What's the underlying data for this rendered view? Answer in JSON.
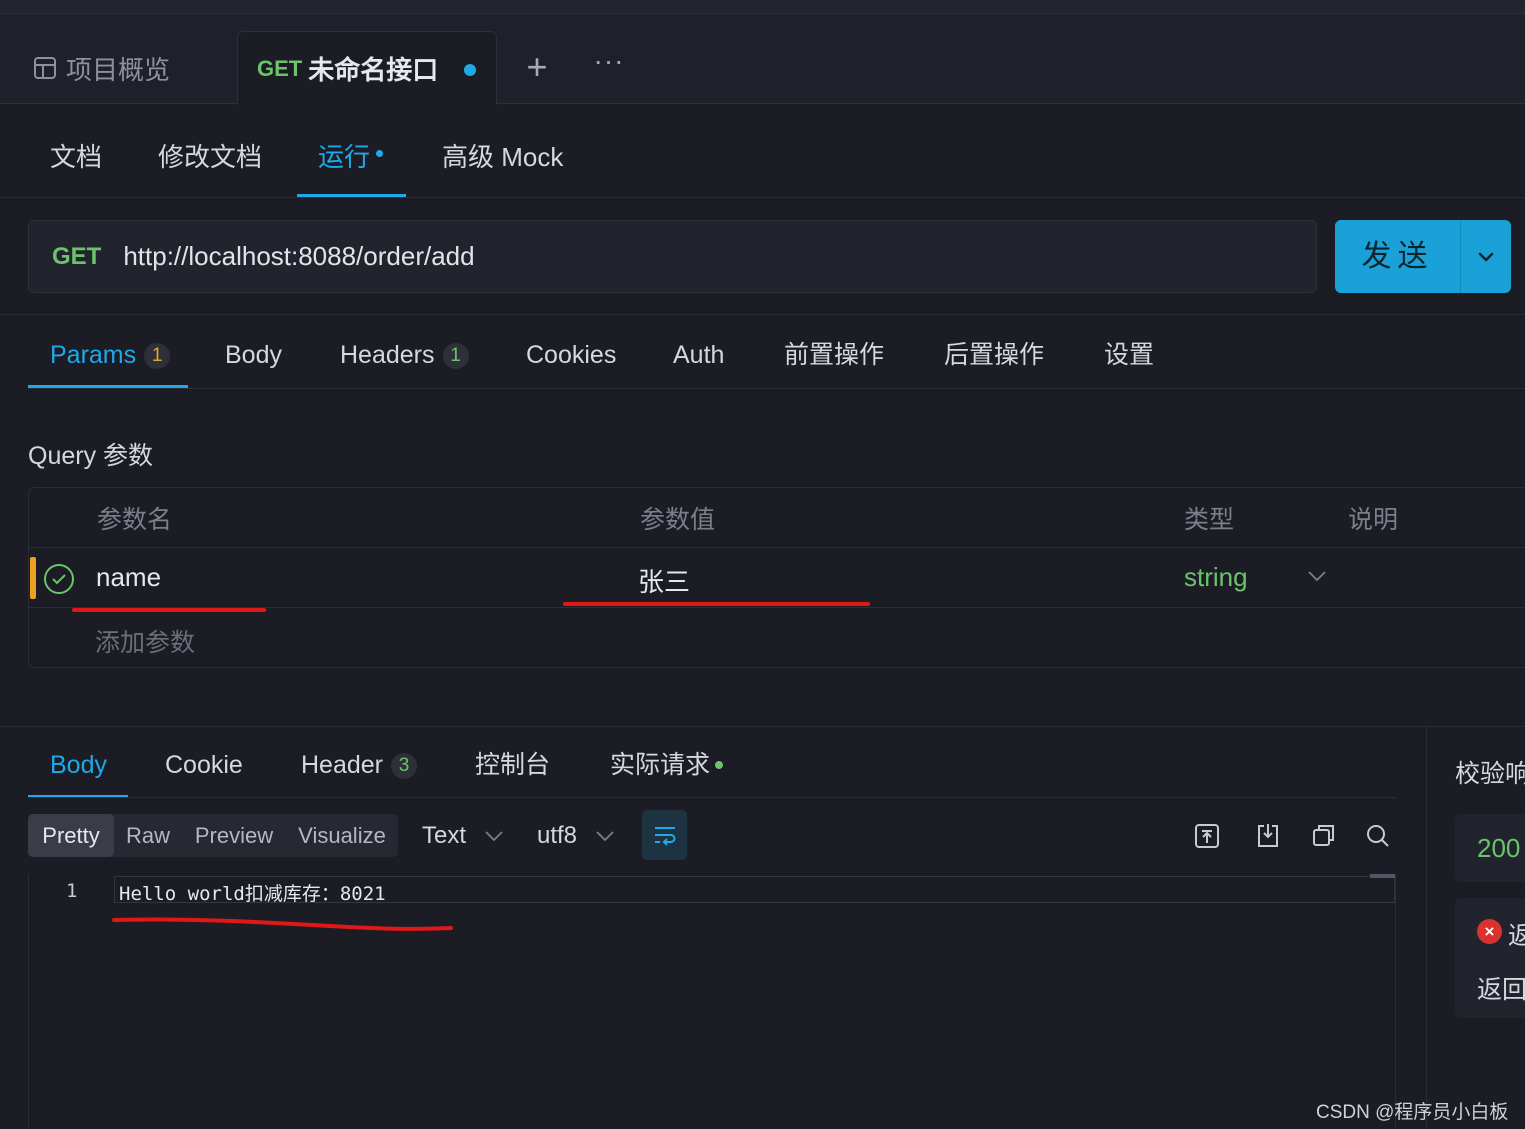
{
  "top_tabs": {
    "overview_label": "项目概览",
    "active_method": "GET",
    "active_name": "未命名接口",
    "plus": "+",
    "more": "···"
  },
  "doc_tabs": [
    {
      "label": "文档"
    },
    {
      "label": "修改文档"
    },
    {
      "label": "运行"
    },
    {
      "label": "高级 Mock"
    }
  ],
  "url_bar": {
    "method": "GET",
    "url": "http://localhost:8088/order/add",
    "send_label": "发送"
  },
  "request_tabs": [
    {
      "label": "Params",
      "badge": "1"
    },
    {
      "label": "Body"
    },
    {
      "label": "Headers",
      "badge": "1"
    },
    {
      "label": "Cookies"
    },
    {
      "label": "Auth"
    },
    {
      "label": "前置操作"
    },
    {
      "label": "后置操作"
    },
    {
      "label": "设置"
    }
  ],
  "query": {
    "title": "Query 参数",
    "headers": [
      "参数名",
      "参数值",
      "类型",
      "说明"
    ],
    "rows": [
      {
        "name": "name",
        "value": "张三",
        "type": "string",
        "desc": ""
      }
    ],
    "add_placeholder": "添加参数"
  },
  "response_tabs": [
    {
      "label": "Body"
    },
    {
      "label": "Cookie"
    },
    {
      "label": "Header",
      "badge": "3"
    },
    {
      "label": "控制台"
    },
    {
      "label": "实际请求"
    }
  ],
  "response_view": {
    "modes": [
      "Pretty",
      "Raw",
      "Preview",
      "Visualize"
    ],
    "active_mode": "Pretty",
    "format": "Text",
    "encoding": "utf8"
  },
  "editor": {
    "lines": [
      {
        "no": "1",
        "text": "Hello world扣减库存：8021"
      }
    ]
  },
  "assert_panel": {
    "title": "校验响",
    "status": "200",
    "error_icon": "×",
    "error_line1": "返",
    "error_line2": "返回"
  },
  "watermark": "CSDN @程序员小白板",
  "colors": {
    "accent": "#1ea9e8",
    "method_get": "#6cc36b",
    "send_button": "#1aa2d8",
    "annotation_red": "#e01818",
    "badge_orange": "#e8a33a"
  }
}
